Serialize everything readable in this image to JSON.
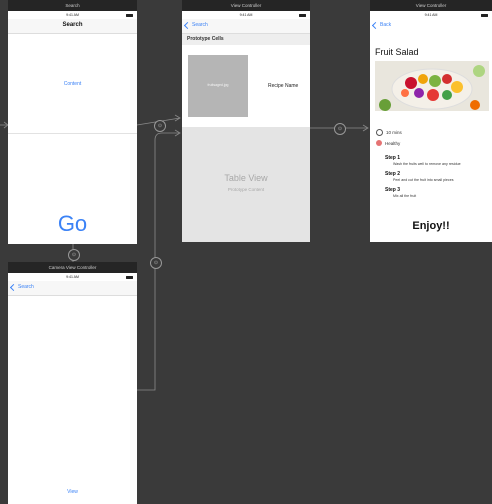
{
  "scenes": {
    "search": {
      "title": "Search",
      "time": "9:41 AM",
      "nav_title": "Search",
      "content_label": "Content",
      "go_label": "Go"
    },
    "view_controller_1": {
      "title": "View Controller",
      "time": "9:41 AM",
      "back_label": "Search",
      "section_header": "Prototype Cells",
      "image_placeholder": "fruitsaged.jpg",
      "recipe_name": "Recipe Name",
      "table_view_label": "Table View",
      "prototype_content_label": "Prototype Content"
    },
    "view_controller_2": {
      "title": "View Controller",
      "time": "9:41 AM",
      "back_label": "Back",
      "recipe_title": "Fruit Salad",
      "time_label": "10 mins",
      "health_label": "Healthy",
      "steps": [
        {
          "title": "Step 1",
          "text": "Wash the fruits well to remove any residue"
        },
        {
          "title": "Step 2",
          "text": "Peel and cut the fruit into small pieces"
        },
        {
          "title": "Step 3",
          "text": "Mix all the fruit"
        }
      ],
      "enjoy_label": "Enjoy!!"
    },
    "camera": {
      "title": "Camera View Controller",
      "time": "9:41 AM",
      "back_label": "Search",
      "view_label": "View"
    }
  },
  "colors": {
    "canvas": "#3a3a3a",
    "accent": "#3b82f6",
    "scene_title_bar": "#252525"
  }
}
